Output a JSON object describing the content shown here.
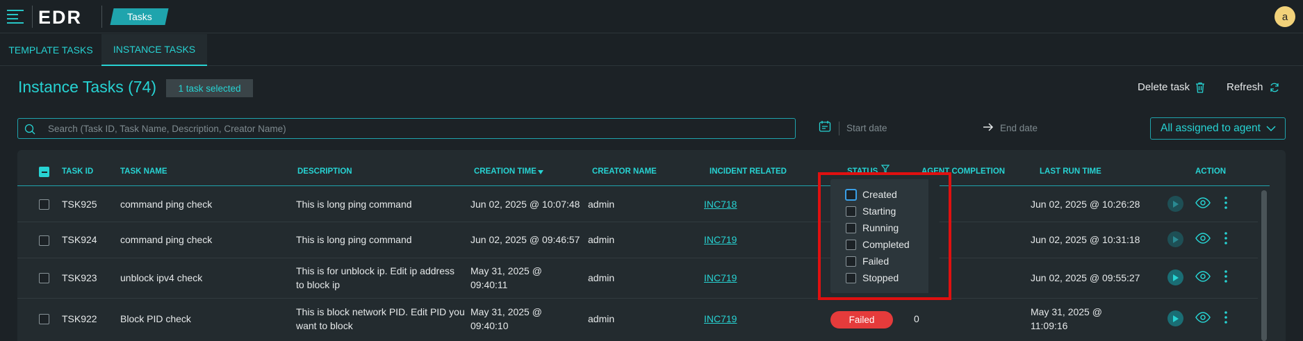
{
  "app": {
    "logo": "EDR",
    "breadcrumb": "Tasks",
    "avatar_initial": "a"
  },
  "tabs": [
    {
      "label": "TEMPLATE TASKS",
      "active": false
    },
    {
      "label": "INSTANCE TASKS",
      "active": true
    }
  ],
  "page": {
    "title": "Instance Tasks (74)",
    "selected_badge": "1 task selected",
    "delete_label": "Delete task",
    "refresh_label": "Refresh"
  },
  "filters": {
    "search_placeholder": "Search (Task ID, Task Name, Description, Creator Name)",
    "start_date_placeholder": "Start date",
    "end_date_placeholder": "End date",
    "assign_select": "All assigned to agent"
  },
  "table": {
    "headers": [
      "TASK ID",
      "TASK NAME",
      "DESCRIPTION",
      "CREATION TIME",
      "CREATOR NAME",
      "INCIDENT RELATED",
      "STATUS",
      "AGENT COMPLETION",
      "LAST RUN TIME",
      "ACTION"
    ],
    "rows": [
      {
        "id": "TSK925",
        "name": "command ping check",
        "desc": "This is long ping command",
        "desc2": "",
        "created": "Jun 02, 2025 @ 10:07:48",
        "created2": "",
        "creator": "admin",
        "incident": "INC718",
        "status": "",
        "completion": "",
        "last_run": "Jun 02, 2025 @ 10:26:28",
        "last_run2": ""
      },
      {
        "id": "TSK924",
        "name": "command ping check",
        "desc": "This is long ping command",
        "desc2": "",
        "created": "Jun 02, 2025 @ 09:46:57",
        "created2": "",
        "creator": "admin",
        "incident": "INC719",
        "status": "",
        "completion": "",
        "last_run": "Jun 02, 2025 @ 10:31:18",
        "last_run2": ""
      },
      {
        "id": "TSK923",
        "name": "unblock ipv4 check",
        "desc": "This is for unblock ip. Edit ip address",
        "desc2": "to block ip",
        "created": "May 31, 2025 @",
        "created2": "09:40:11",
        "creator": "admin",
        "incident": "INC719",
        "status": "",
        "completion": "",
        "last_run": "Jun 02, 2025 @ 09:55:27",
        "last_run2": ""
      },
      {
        "id": "TSK922",
        "name": "Block PID check",
        "desc": "This is block network PID. Edit PID you",
        "desc2": "want to block",
        "created": "May 31, 2025 @",
        "created2": "09:40:10",
        "creator": "admin",
        "incident": "INC719",
        "status": "Failed",
        "completion": "0",
        "last_run": "May 31, 2025 @",
        "last_run2": "11:09:16"
      }
    ]
  },
  "status_filter": {
    "options": [
      "Created",
      "Starting",
      "Running",
      "Completed",
      "Failed",
      "Stopped"
    ]
  },
  "colors": {
    "accent": "#27d3d3",
    "background": "#1c2226",
    "panel": "#232b2f",
    "failed": "#e53b3b",
    "highlight": "#e01010"
  }
}
